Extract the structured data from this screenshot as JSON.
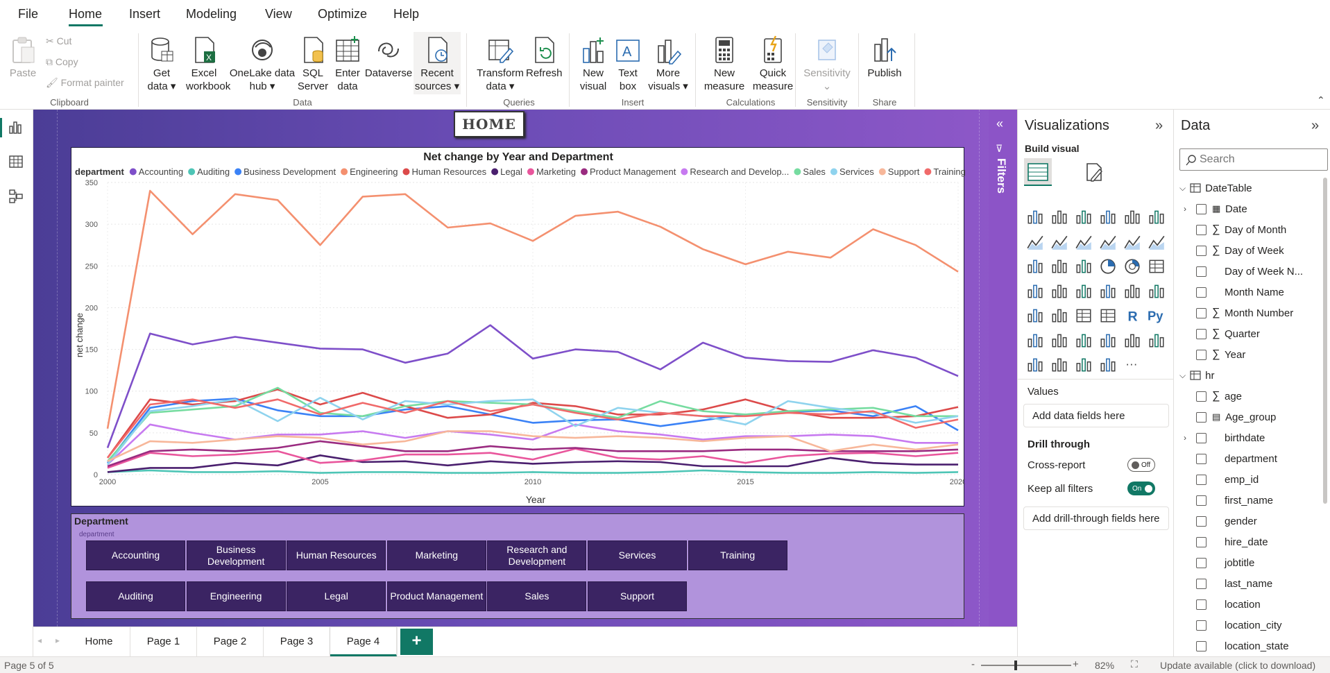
{
  "menu": {
    "items": [
      "File",
      "Home",
      "Insert",
      "Modeling",
      "View",
      "Optimize",
      "Help"
    ],
    "active": "Home"
  },
  "ribbon": {
    "clipboard": {
      "paste": "Paste",
      "cut": "Cut",
      "copy": "Copy",
      "format_painter": "Format painter",
      "label": "Clipboard"
    },
    "data": {
      "get_data_1": "Get",
      "get_data_2": "data",
      "excel_1": "Excel",
      "excel_2": "workbook",
      "onelake_1": "OneLake data",
      "onelake_2": "hub",
      "sql_1": "SQL",
      "sql_2": "Server",
      "enter_1": "Enter",
      "enter_2": "data",
      "dataverse": "Dataverse",
      "recent_1": "Recent",
      "recent_2": "sources",
      "label": "Data"
    },
    "queries": {
      "transform_1": "Transform",
      "transform_2": "data",
      "refresh": "Refresh",
      "label": "Queries"
    },
    "insert": {
      "new_visual_1": "New",
      "new_visual_2": "visual",
      "text_box_1": "Text",
      "text_box_2": "box",
      "more_visuals_1": "More",
      "more_visuals_2": "visuals",
      "label": "Insert"
    },
    "calculations": {
      "new_measure_1": "New",
      "new_measure_2": "measure",
      "quick_measure_1": "Quick",
      "quick_measure_2": "measure",
      "label": "Calculations"
    },
    "sensitivity": {
      "sensitivity": "Sensitivity",
      "label": "Sensitivity"
    },
    "share": {
      "publish": "Publish",
      "label": "Share"
    }
  },
  "canvas": {
    "home_button": "HOME"
  },
  "chart_data": {
    "type": "line",
    "title": "Net change by Year and Department",
    "legend_title": "department",
    "xlabel": "Year",
    "ylabel": "net change",
    "ylim": [
      0,
      350
    ],
    "xlim": [
      2000,
      2020
    ],
    "yticks": [
      0,
      50,
      100,
      150,
      200,
      250,
      300,
      350
    ],
    "xticks": [
      2000,
      2005,
      2010,
      2015,
      2020
    ],
    "x": [
      2000,
      2001,
      2002,
      2003,
      2004,
      2005,
      2006,
      2007,
      2008,
      2009,
      2010,
      2011,
      2012,
      2013,
      2014,
      2015,
      2016,
      2017,
      2018,
      2019,
      2020
    ],
    "series": [
      {
        "name": "Accounting",
        "color": "#7e4fc9",
        "values": [
          32,
          169,
          156,
          165,
          158,
          151,
          150,
          134,
          145,
          179,
          139,
          150,
          147,
          126,
          158,
          140,
          136,
          135,
          149,
          140,
          118
        ]
      },
      {
        "name": "Auditing",
        "color": "#4ec5b6",
        "values": [
          3,
          5,
          3,
          3,
          4,
          2,
          3,
          3,
          2,
          2,
          3,
          2,
          2,
          3,
          5,
          3,
          2,
          2,
          3,
          2,
          3
        ]
      },
      {
        "name": "Business Development",
        "color": "#3b82f6",
        "values": [
          14,
          80,
          88,
          91,
          77,
          70,
          70,
          78,
          82,
          72,
          62,
          65,
          66,
          58,
          65,
          72,
          75,
          77,
          70,
          82,
          53
        ]
      },
      {
        "name": "Engineering",
        "color": "#f4906f",
        "values": [
          55,
          340,
          288,
          336,
          329,
          275,
          333,
          336,
          296,
          301,
          280,
          310,
          315,
          297,
          270,
          252,
          267,
          260,
          294,
          275,
          243
        ]
      },
      {
        "name": "Human Resources",
        "color": "#dc4a4a",
        "values": [
          20,
          90,
          84,
          88,
          102,
          84,
          98,
          82,
          68,
          72,
          86,
          82,
          72,
          72,
          78,
          90,
          76,
          68,
          68,
          70,
          81
        ]
      },
      {
        "name": "Legal",
        "color": "#4a1f6e",
        "values": [
          3,
          8,
          8,
          14,
          11,
          23,
          15,
          16,
          11,
          16,
          13,
          15,
          16,
          15,
          10,
          10,
          10,
          20,
          14,
          12,
          12
        ]
      },
      {
        "name": "Marketing",
        "color": "#e9569c",
        "values": [
          8,
          26,
          22,
          24,
          28,
          14,
          17,
          24,
          24,
          26,
          18,
          31,
          20,
          18,
          22,
          14,
          22,
          25,
          26,
          22,
          26
        ]
      },
      {
        "name": "Product Management",
        "color": "#9a2b80",
        "values": [
          10,
          28,
          30,
          28,
          32,
          40,
          34,
          28,
          28,
          34,
          30,
          32,
          28,
          28,
          28,
          30,
          30,
          28,
          28,
          28,
          30
        ]
      },
      {
        "name": "Research and Development",
        "color": "#c77af0",
        "values": [
          12,
          60,
          50,
          42,
          48,
          48,
          52,
          44,
          52,
          48,
          42,
          60,
          52,
          48,
          42,
          46,
          46,
          48,
          46,
          38,
          38
        ]
      },
      {
        "name": "Sales",
        "color": "#76dca0",
        "values": [
          16,
          74,
          78,
          82,
          104,
          74,
          70,
          82,
          88,
          86,
          84,
          76,
          68,
          88,
          76,
          72,
          76,
          78,
          80,
          70,
          70
        ]
      },
      {
        "name": "Services",
        "color": "#8fd3ee",
        "values": [
          12,
          76,
          82,
          90,
          64,
          92,
          66,
          88,
          84,
          88,
          90,
          58,
          80,
          74,
          70,
          60,
          88,
          80,
          74,
          62,
          70
        ]
      },
      {
        "name": "Support",
        "color": "#f7b79a",
        "values": [
          16,
          40,
          38,
          42,
          46,
          44,
          36,
          40,
          52,
          52,
          46,
          44,
          46,
          44,
          40,
          44,
          46,
          28,
          36,
          30,
          36
        ]
      },
      {
        "name": "Training",
        "color": "#f06a6a",
        "values": [
          20,
          84,
          90,
          80,
          90,
          72,
          86,
          74,
          88,
          76,
          84,
          74,
          66,
          74,
          70,
          70,
          74,
          72,
          76,
          56,
          66
        ]
      }
    ]
  },
  "slicer": {
    "title": "Department",
    "field": "department",
    "items": [
      "Accounting",
      "Business Development",
      "Human Resources",
      "Marketing",
      "Research and Development",
      "Services",
      "Training",
      "Auditing",
      "Engineering",
      "Legal",
      "Product Management",
      "Sales",
      "Support"
    ]
  },
  "filters": {
    "label": "Filters"
  },
  "tabs": {
    "items": [
      "Home",
      "Page 1",
      "Page 2",
      "Page 3",
      "Page 4"
    ],
    "active": "Page 4",
    "add": "+"
  },
  "status": {
    "page": "Page 5 of 5",
    "zoom": "82%",
    "update": "Update available (click to download)"
  },
  "viz": {
    "title": "Visualizations",
    "build": "Build visual",
    "values": "Values",
    "add_data": "Add data fields here",
    "drill": "Drill through",
    "cross_report": "Cross-report",
    "cross_state": "Off",
    "keep_filters": "Keep all filters",
    "keep_state": "On",
    "add_drill": "Add drill-through fields here"
  },
  "data_pane": {
    "title": "Data",
    "search_placeholder": "Search",
    "tables": [
      {
        "name": "DateTable",
        "fields": [
          {
            "name": "Date",
            "type": "calendar",
            "expand": true
          },
          {
            "name": "Day of Month",
            "type": "sum"
          },
          {
            "name": "Day of Week",
            "type": "sum"
          },
          {
            "name": "Day of Week N...",
            "type": "text"
          },
          {
            "name": "Month Name",
            "type": "text"
          },
          {
            "name": "Month Number",
            "type": "sum"
          },
          {
            "name": "Quarter",
            "type": "sum"
          },
          {
            "name": "Year",
            "type": "sum"
          }
        ]
      },
      {
        "name": "hr",
        "fields": [
          {
            "name": "age",
            "type": "sum"
          },
          {
            "name": "Age_group",
            "type": "calc"
          },
          {
            "name": "birthdate",
            "type": "text",
            "expand": true
          },
          {
            "name": "department",
            "type": "text"
          },
          {
            "name": "emp_id",
            "type": "text"
          },
          {
            "name": "first_name",
            "type": "text"
          },
          {
            "name": "gender",
            "type": "text"
          },
          {
            "name": "hire_date",
            "type": "text"
          },
          {
            "name": "jobtitle",
            "type": "text"
          },
          {
            "name": "last_name",
            "type": "text"
          },
          {
            "name": "location",
            "type": "text"
          },
          {
            "name": "location_city",
            "type": "text"
          },
          {
            "name": "location_state",
            "type": "text"
          }
        ]
      }
    ]
  }
}
